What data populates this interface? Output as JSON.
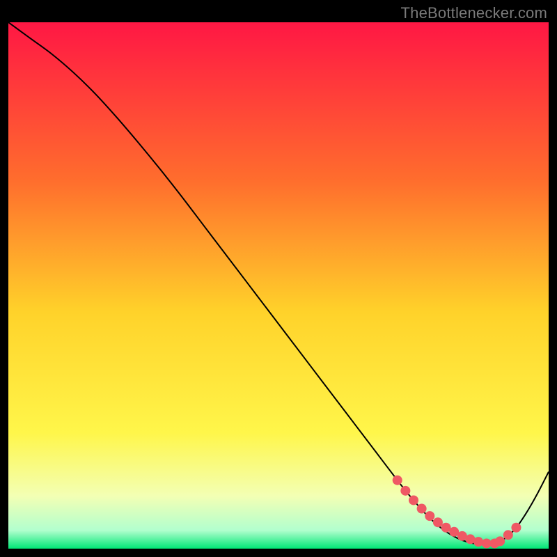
{
  "watermark": "TheBottlenecker.com",
  "chart_data": {
    "type": "line",
    "title": "",
    "xlabel": "",
    "ylabel": "",
    "xlim": [
      0,
      100
    ],
    "ylim": [
      0,
      100
    ],
    "grid": false,
    "legend": false,
    "background_gradient_stops": [
      {
        "offset": 0.0,
        "color": "#ff1744"
      },
      {
        "offset": 0.3,
        "color": "#ff6d2d"
      },
      {
        "offset": 0.55,
        "color": "#ffd22a"
      },
      {
        "offset": 0.78,
        "color": "#fff64a"
      },
      {
        "offset": 0.9,
        "color": "#f3ffb4"
      },
      {
        "offset": 0.965,
        "color": "#b2ffce"
      },
      {
        "offset": 1.0,
        "color": "#00e676"
      }
    ],
    "series": [
      {
        "name": "bottleneck-curve",
        "color": "#000000",
        "x": [
          0,
          4,
          8,
          12,
          16,
          20,
          24,
          28,
          32,
          36,
          40,
          44,
          48,
          52,
          56,
          60,
          64,
          68,
          72,
          74,
          76,
          78,
          80,
          82,
          84,
          86,
          88,
          90,
          92,
          94,
          96,
          98,
          100
        ],
        "y": [
          100,
          97,
          94,
          90.5,
          86.5,
          82,
          77.2,
          72.2,
          67.0,
          61.6,
          56.2,
          50.8,
          45.4,
          40.0,
          34.6,
          29.2,
          23.8,
          18.4,
          13.0,
          10.4,
          8.0,
          5.8,
          4.0,
          2.6,
          1.6,
          1.0,
          0.8,
          1.0,
          2.0,
          4.0,
          7.0,
          10.6,
          14.6
        ]
      }
    ],
    "markers": {
      "name": "highlight-points",
      "color": "#ef5864",
      "radius": 7,
      "x": [
        72.0,
        73.5,
        75.0,
        76.5,
        78.0,
        79.5,
        81.0,
        82.5,
        84.0,
        85.5,
        87.0,
        88.5,
        90.0,
        91.0,
        92.5,
        94.0
      ],
      "y": [
        13.0,
        11.0,
        9.2,
        7.6,
        6.2,
        5.0,
        4.0,
        3.2,
        2.4,
        1.8,
        1.3,
        1.0,
        1.0,
        1.4,
        2.6,
        4.0
      ]
    }
  }
}
